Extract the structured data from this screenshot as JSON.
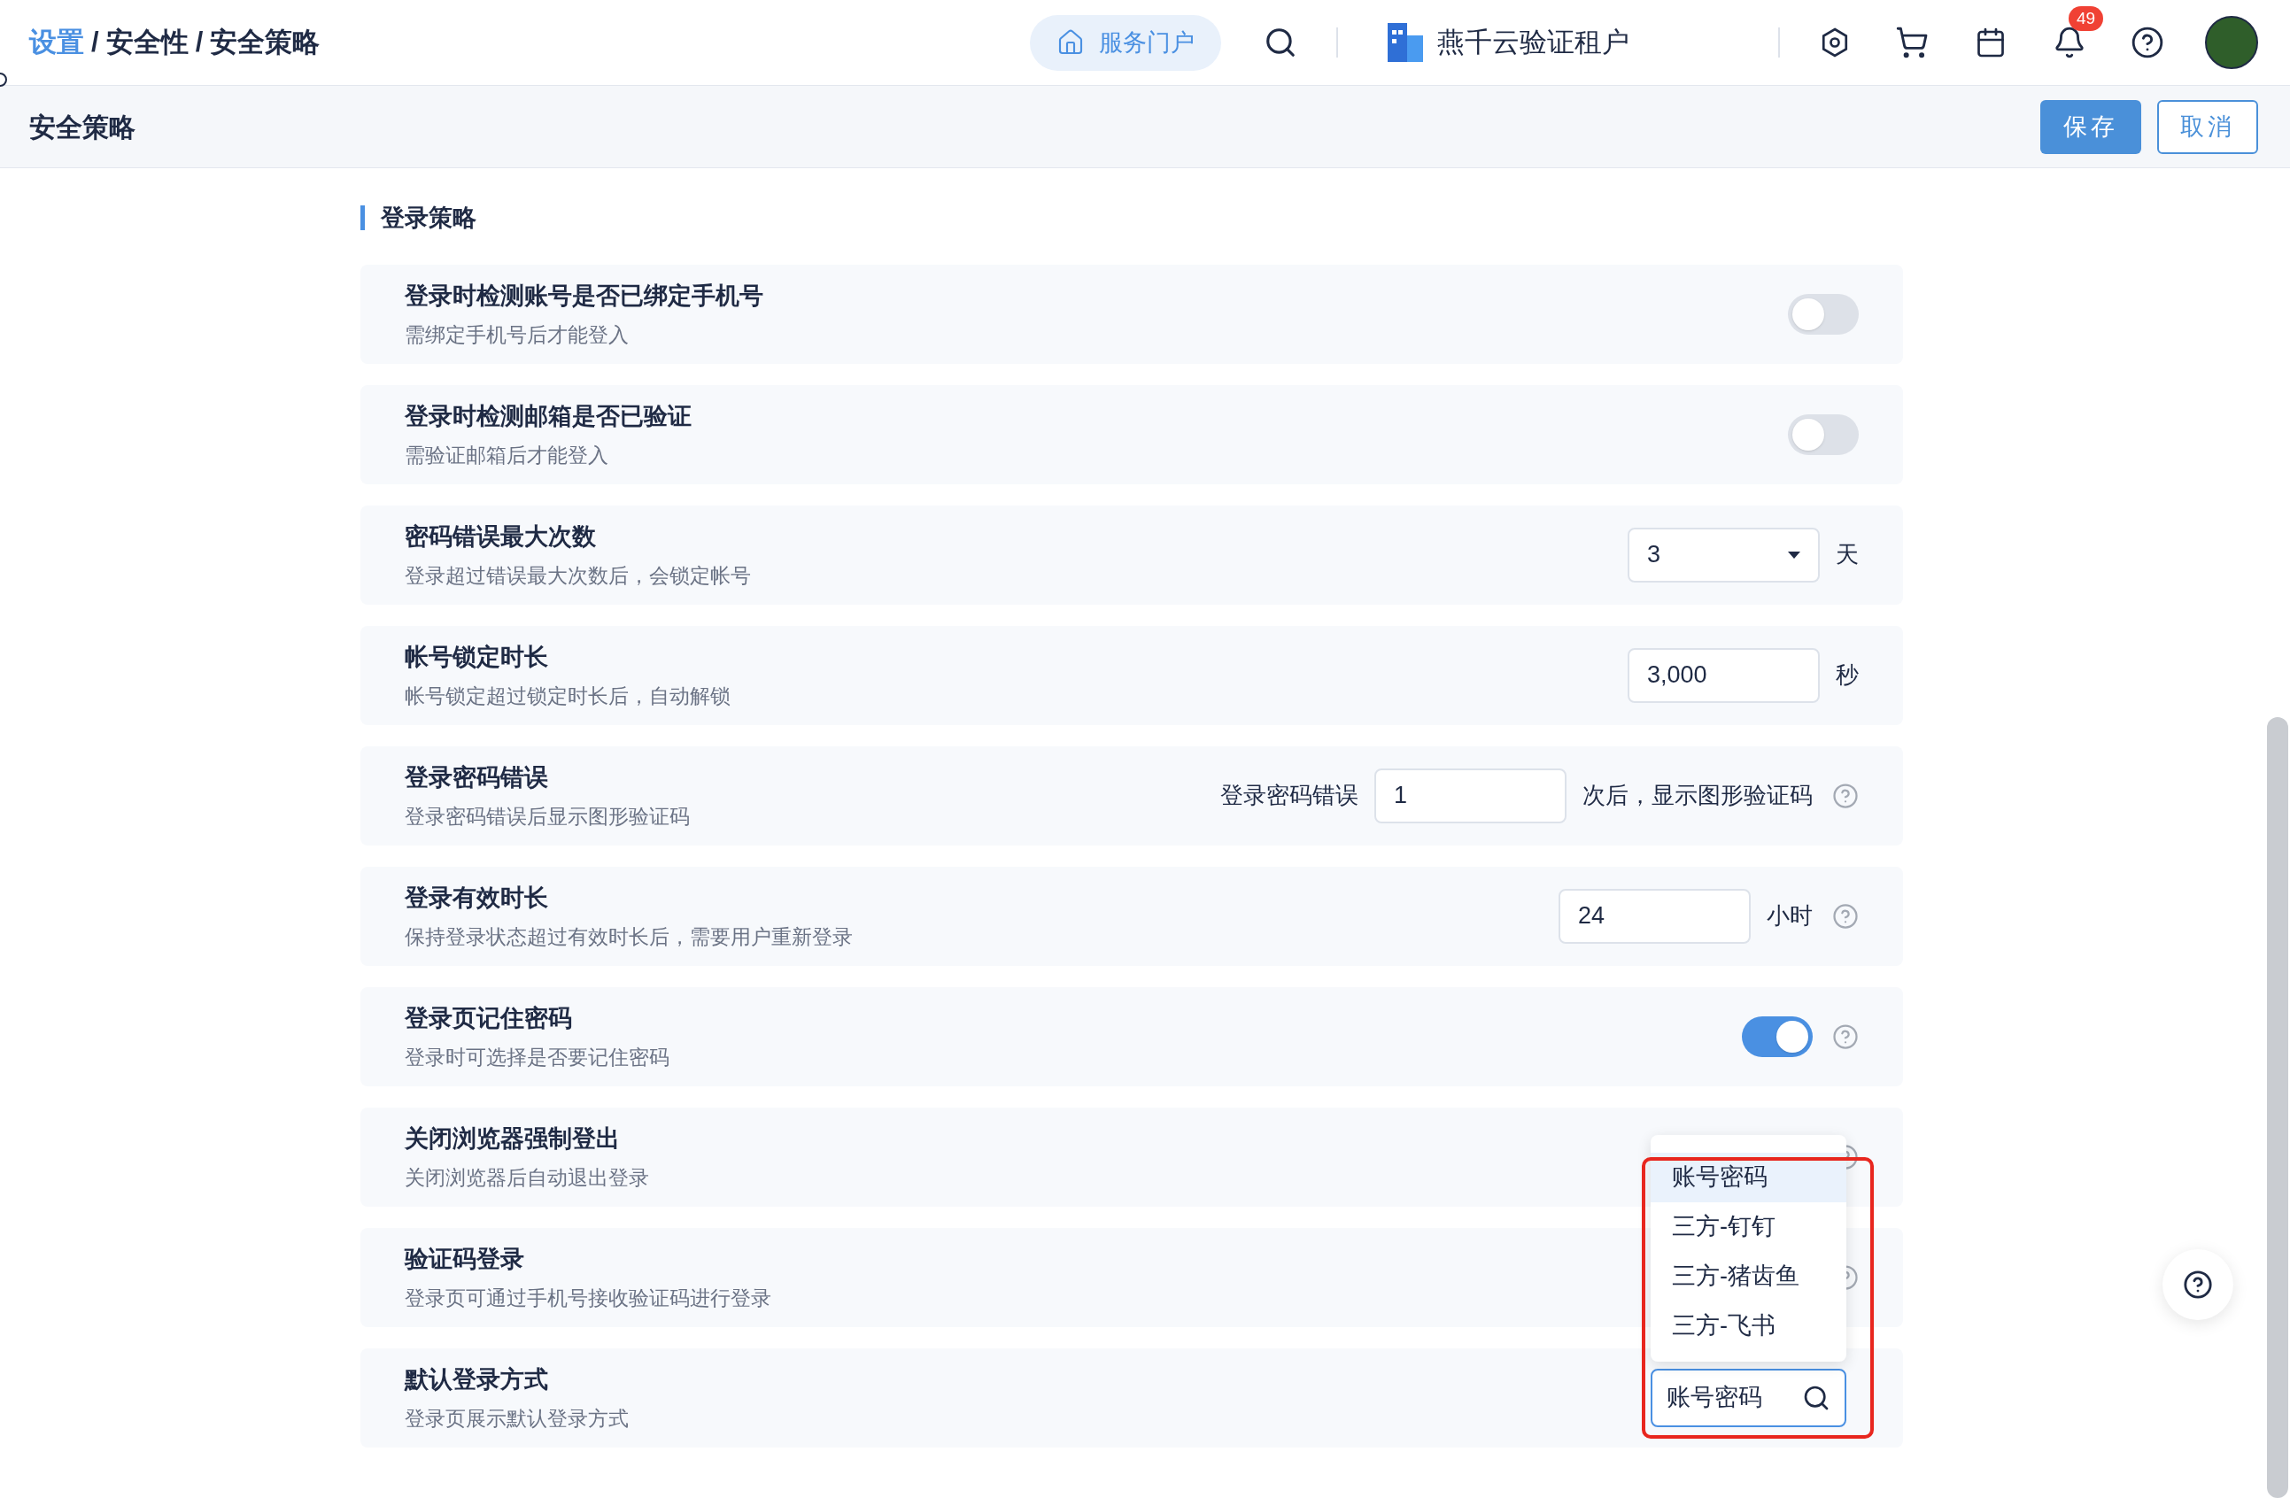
{
  "breadcrumb": {
    "separator": "/",
    "items": [
      {
        "label": "设置",
        "kind": "link"
      },
      {
        "label": "安全性",
        "kind": "current"
      },
      {
        "label": "安全策略",
        "kind": "current"
      }
    ]
  },
  "topbar": {
    "portal_button": "服务门户",
    "tenant": "燕千云验证租户",
    "notification_count": "49"
  },
  "page_title": "安全策略",
  "actions": [
    {
      "label": "保存",
      "kind": "primary"
    },
    {
      "label": "取消",
      "kind": "secondary"
    }
  ],
  "section_title": "登录策略",
  "settings": [
    {
      "title": "登录时检测账号是否已绑定手机号",
      "description": "需绑定手机号后才能登入",
      "kind": "switch",
      "on": false,
      "help": false
    },
    {
      "title": "登录时检测邮箱是否已验证",
      "description": "需验证邮箱后才能登入",
      "kind": "switch",
      "on": false,
      "help": false
    },
    {
      "title": "密码错误最大次数",
      "description": "登录超过错误最大次数后，会锁定帐号",
      "kind": "select",
      "value": "3",
      "unit": "天",
      "help": false
    },
    {
      "title": "帐号锁定时长",
      "description": "帐号锁定超过锁定时长后，自动解锁",
      "kind": "input",
      "value": "3,000",
      "unit": "秒",
      "help": false
    },
    {
      "title": "登录密码错误",
      "description": "登录密码错误后显示图形验证码",
      "kind": "input",
      "prefix": "登录密码错误",
      "value": "1",
      "unit": "次后，显示图形验证码",
      "help": true
    },
    {
      "title": "登录有效时长",
      "description": "保持登录状态超过有效时长后，需要用户重新登录",
      "kind": "input",
      "value": "24",
      "unit": "小时",
      "help": true
    },
    {
      "title": "登录页记住密码",
      "description": "登录时可选择是否要记住密码",
      "kind": "switch",
      "on": true,
      "help": true
    },
    {
      "title": "关闭浏览器强制登出",
      "description": "关闭浏览器后自动退出登录",
      "kind": "covered",
      "help": true
    },
    {
      "title": "验证码登录",
      "description": "登录页可通过手机号接收验证码进行登录",
      "kind": "covered",
      "help": true
    },
    {
      "title": "默认登录方式",
      "description": "登录页展示默认登录方式",
      "kind": "search-select",
      "value": "账号密码",
      "help": false
    }
  ],
  "dropdown": {
    "options": [
      {
        "label": "账号密码",
        "selected": true
      },
      {
        "label": "三方-钉钉",
        "selected": false
      },
      {
        "label": "三方-猪齿鱼",
        "selected": false
      },
      {
        "label": "三方-飞书",
        "selected": false
      }
    ]
  }
}
